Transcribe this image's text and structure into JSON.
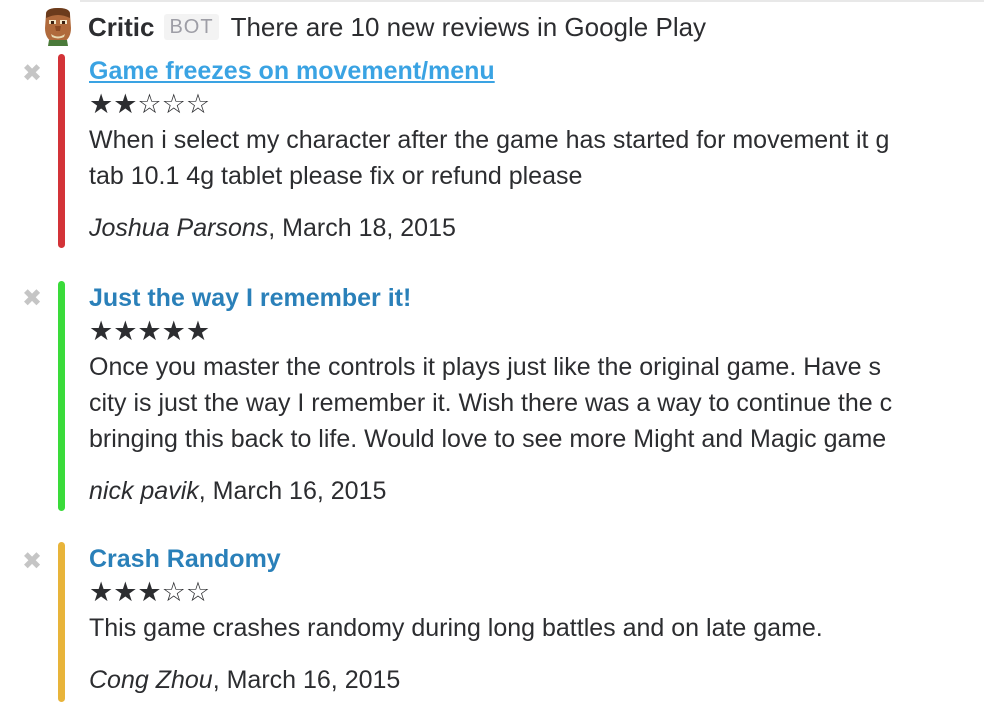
{
  "message": {
    "sender": "Critic",
    "badge": "BOT",
    "text": "There are 10 new reviews in Google Play",
    "avatar_icon": "doom-guy-face-icon"
  },
  "colors": {
    "bar_red": "#d33338",
    "bar_green": "#3adb3a",
    "bar_yellow": "#e8b43a",
    "title_link": "#3aa3e3",
    "title": "#2a80b9"
  },
  "reviews": [
    {
      "title": "Game freezes on movement/menu",
      "stars": "★★☆☆☆",
      "rating": 2,
      "lines": [
        "When i select my character after the game has started for movement it g",
        "tab 10.1 4g tablet please fix or refund please"
      ],
      "author": "Joshua Parsons",
      "date": ", March 18, 2015"
    },
    {
      "title": "Just the way I remember it!",
      "stars": "★★★★★",
      "rating": 5,
      "lines": [
        "Once you master the controls it plays just like the original game. Have s",
        "city is just the way I remember it. Wish there was a way to continue the c",
        "bringing this back to life. Would love to see more Might and Magic game"
      ],
      "author": "nick pavik",
      "date": ", March 16, 2015"
    },
    {
      "title": "Crash Randomy",
      "stars": "★★★☆☆",
      "rating": 3,
      "lines": [
        "This game crashes randomy during long battles and on late game."
      ],
      "author": "Cong Zhou",
      "date": ", March 16, 2015"
    }
  ],
  "dismiss_glyph": "✖"
}
